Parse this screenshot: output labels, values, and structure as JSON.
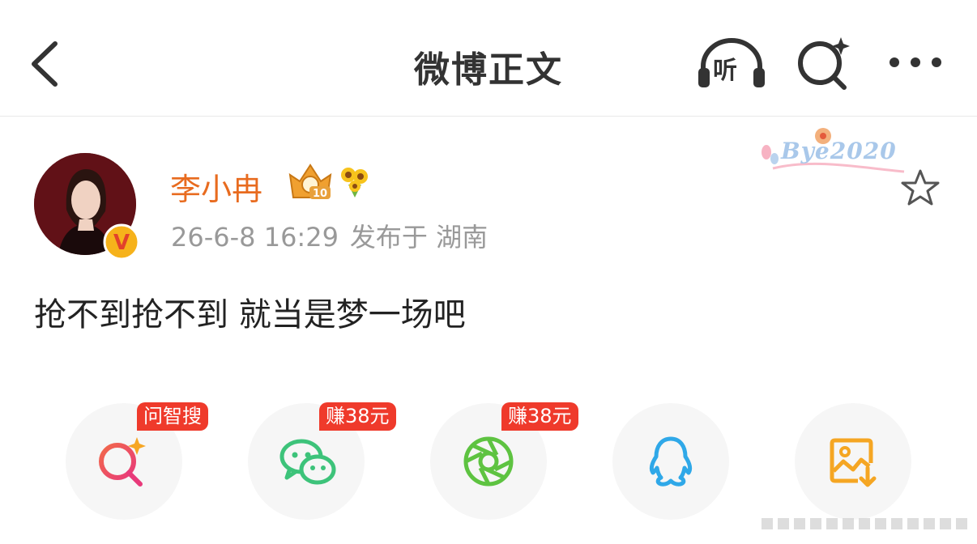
{
  "navbar": {
    "title": "微博正文",
    "back_icon": "chevron-left-icon",
    "listen_label": "听",
    "search_icon": "ai-search-icon",
    "more_icon": "more-dots-icon"
  },
  "post": {
    "author": {
      "name": "李小冉",
      "verified_badge": "V",
      "level_badge": "10"
    },
    "timestamp": "26-6-8 16:29",
    "location": "发布于 湖南",
    "text": "抢不到抢不到 就当是梦一场吧",
    "sticker_text": "Bye2020"
  },
  "share": {
    "items": [
      {
        "name": "ai-search",
        "tag": "问智搜",
        "icon": "ai-search-icon"
      },
      {
        "name": "wechat",
        "tag": "赚38元",
        "icon": "wechat-icon"
      },
      {
        "name": "moments",
        "tag": "赚38元",
        "icon": "moments-icon"
      },
      {
        "name": "qq",
        "tag": "",
        "icon": "qq-icon"
      },
      {
        "name": "save-image",
        "tag": "",
        "icon": "save-image-icon"
      }
    ]
  },
  "colors": {
    "accent_orange": "#e86b1f",
    "tag_red": "#ef3a2b",
    "wechat_green": "#3dc37a",
    "moments_green": "#5ec341",
    "qq_blue": "#2fa8e8",
    "save_orange": "#f5a623"
  }
}
